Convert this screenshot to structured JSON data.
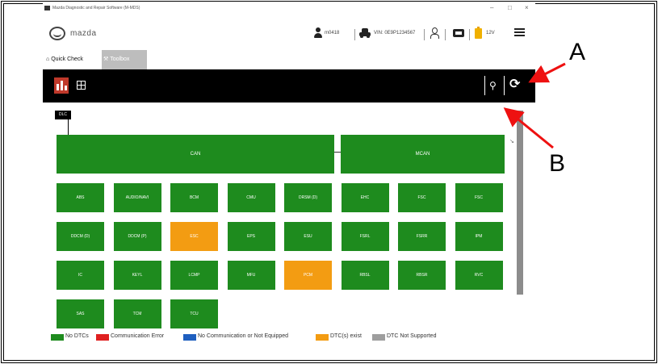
{
  "window": {
    "title": "Mazda Diagnostic and Repair Software (M-MDS)",
    "controls": [
      "–",
      "□",
      "×"
    ]
  },
  "brand": {
    "wordmark": "mazda"
  },
  "header": {
    "user_label": "m0418",
    "vehicle_label": "VIN: 0E9P1234567",
    "battery_label": "12V",
    "icons": [
      "person-icon",
      "car-icon",
      "user-outline-icon",
      "vci-icon",
      "battery-icon",
      "menu-icon"
    ]
  },
  "tabs": [
    {
      "label": "Quick Check",
      "icon": "home-icon",
      "active": true
    },
    {
      "label": "Toolbox",
      "icon": "wrench-icon",
      "active": false
    }
  ],
  "toolbar": {
    "buttons": [
      "network-view-icon",
      "table-view-icon",
      "plug-icon",
      "refresh-icon"
    ]
  },
  "network": {
    "root": "DLC",
    "groups": [
      {
        "label": "CAN"
      },
      {
        "label": "MCAN"
      }
    ],
    "modules": [
      {
        "label": "ABS",
        "status": "ok"
      },
      {
        "label": "AUDIO/NAVI",
        "status": "ok"
      },
      {
        "label": "BCM",
        "status": "ok"
      },
      {
        "label": "CMU",
        "status": "ok"
      },
      {
        "label": "DRSM (D)",
        "status": "ok"
      },
      {
        "label": "EHC",
        "status": "ok"
      },
      {
        "label": "FSC",
        "status": "ok"
      },
      {
        "label": "FSC",
        "status": "ok"
      },
      {
        "label": "DDCM (D)",
        "status": "ok"
      },
      {
        "label": "DDCM (P)",
        "status": "ok"
      },
      {
        "label": "ESC",
        "status": "warn"
      },
      {
        "label": "EPS",
        "status": "ok"
      },
      {
        "label": "ESU",
        "status": "ok"
      },
      {
        "label": "FSRL",
        "status": "ok"
      },
      {
        "label": "FSRR",
        "status": "ok"
      },
      {
        "label": "IPM",
        "status": "ok"
      },
      {
        "label": "IC",
        "status": "ok"
      },
      {
        "label": "KEYL",
        "status": "ok"
      },
      {
        "label": "LCMP",
        "status": "ok"
      },
      {
        "label": "MFU",
        "status": "ok"
      },
      {
        "label": "PCM",
        "status": "warn"
      },
      {
        "label": "RBSL",
        "status": "ok"
      },
      {
        "label": "RBSR",
        "status": "ok"
      },
      {
        "label": "RVC",
        "status": "ok"
      },
      {
        "label": "SAS",
        "status": "ok"
      },
      {
        "label": "TCM",
        "status": "ok"
      },
      {
        "label": "TCU",
        "status": "ok"
      }
    ]
  },
  "legend": [
    {
      "label": "No DTCs",
      "color": "#1e8b1e"
    },
    {
      "label": "Communication Error",
      "color": "#e02020"
    },
    {
      "label": "No Communication or Not Equipped",
      "color": "#1f5fbf"
    },
    {
      "label": "DTC(s) exist",
      "color": "#f39c12"
    },
    {
      "label": "DTC Not Supported",
      "color": "#9e9e9e"
    }
  ],
  "annotations": {
    "a": "A",
    "b": "B"
  }
}
